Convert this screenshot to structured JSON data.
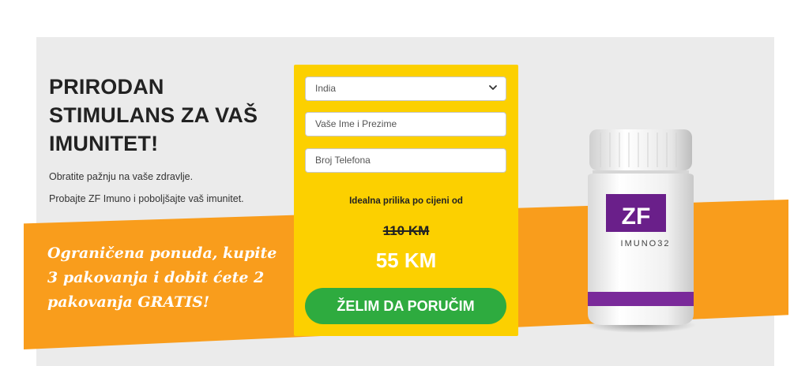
{
  "hero": {
    "headline": "PRIRODAN STIMULANS ZA VAŠ IMUNITET!",
    "subtitle_1": "Obratite pažnju na vaše zdravlje.",
    "subtitle_2": "Probajte ZF Imuno i poboljšajte vaš imunitet.",
    "promo": "Ograničena ponuda, kupite 3 pakovanja i dobit ćete 2 pakovanja GRATIS!"
  },
  "form": {
    "country_value": "India",
    "name_placeholder": "Vaše Ime i Prezime",
    "phone_placeholder": "Broj Telefona",
    "price_label": "Idealna prilika po cijeni od",
    "old_price": "110 KM",
    "new_price": "55 KM",
    "order_button": "ŽELIM DA PORUČIM"
  },
  "product": {
    "brand": "ZF",
    "name": "IMUNO32"
  },
  "colors": {
    "panel": "#ebebeb",
    "band": "#f99d1c",
    "form": "#fcd000",
    "button": "#2eab3f",
    "label": "#6a1f8a"
  },
  "icons": {
    "select_arrow": "chevron-down-icon"
  }
}
